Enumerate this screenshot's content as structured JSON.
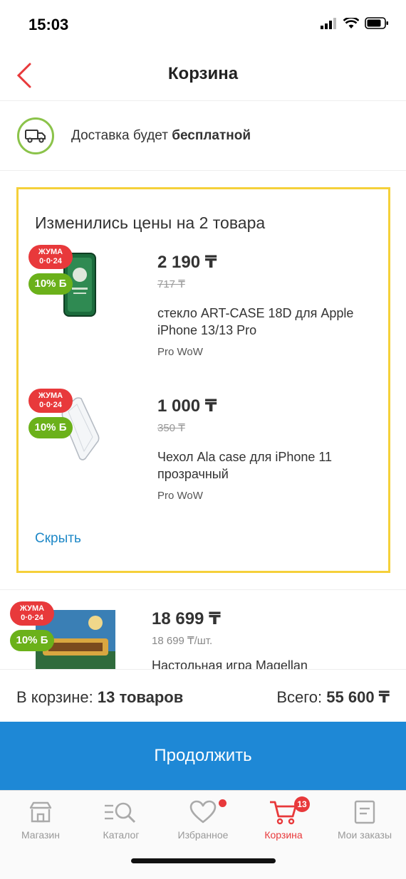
{
  "status": {
    "time": "15:03"
  },
  "header": {
    "title": "Корзина"
  },
  "delivery": {
    "text": "Доставка будет ",
    "bold": "бесплатной"
  },
  "changed": {
    "title": "Изменились цены на 2 товара",
    "items": [
      {
        "badge_top": "ЖУМА",
        "badge_code": "0·0·24",
        "bonus": "10% Б",
        "price": "2 190 ₸",
        "old_price": "717 ₸",
        "name": "стекло ART-CASE 18D для Apple iPhone 13/13 Pro",
        "seller": "Pro WoW"
      },
      {
        "badge_top": "ЖУМА",
        "badge_code": "0·0·24",
        "bonus": "10% Б",
        "price": "1 000 ₸",
        "old_price": "350 ₸",
        "name": "Чехол Ala case для iPhone 11 прозрачный",
        "seller": "Pro WoW"
      }
    ],
    "hide_label": "Скрыть"
  },
  "cart_item": {
    "badge_top": "ЖУМА",
    "badge_code": "0·0·24",
    "bonus": "10% Б",
    "price": "18 699 ₸",
    "unit_price": "18 699 ₸/шт.",
    "name": "Настольная игра Magellan"
  },
  "totals": {
    "left_label": "В корзине: ",
    "left_value": "13 товаров",
    "right_label": "Всего: ",
    "right_value": "55 600 ₸"
  },
  "continue_label": "Продолжить",
  "tabs": [
    {
      "label": "Магазин",
      "icon": "store-icon"
    },
    {
      "label": "Каталог",
      "icon": "catalog-search-icon"
    },
    {
      "label": "Избранное",
      "icon": "heart-icon"
    },
    {
      "label": "Корзина",
      "icon": "cart-icon",
      "badge": "13"
    },
    {
      "label": "Мои заказы",
      "icon": "orders-icon"
    }
  ],
  "colors": {
    "accent_red": "#e8393b",
    "primary_blue": "#1e88d6",
    "highlight_yellow": "#f5d03a",
    "bonus_green": "#6bb11a"
  }
}
